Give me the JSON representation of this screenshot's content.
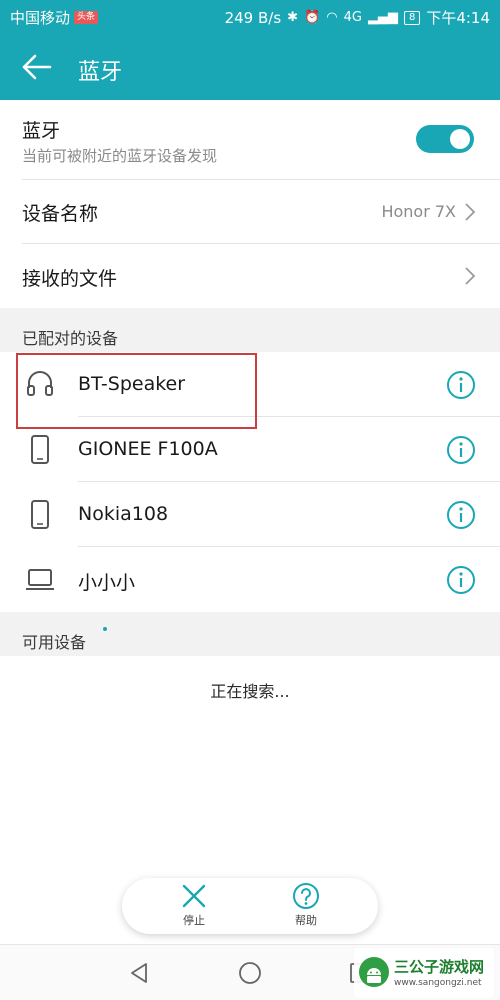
{
  "status_bar": {
    "carrier": "中国移动",
    "carrier_tag": "头条",
    "speed": "249 B/s",
    "network": "4G",
    "battery": "8",
    "time": "下午4:14"
  },
  "app_bar": {
    "title": "蓝牙",
    "back_icon": "arrow-left-icon"
  },
  "bluetooth": {
    "title": "蓝牙",
    "subtitle": "当前可被附近的蓝牙设备发现",
    "enabled": true
  },
  "device_name": {
    "label": "设备名称",
    "value": "Honor 7X"
  },
  "received_files": {
    "label": "接收的文件"
  },
  "paired_section": {
    "label": "已配对的设备",
    "devices": [
      {
        "name": "BT-Speaker",
        "icon": "headphones-icon"
      },
      {
        "name": "GIONEE F100A",
        "icon": "phone-icon"
      },
      {
        "name": "Nokia108",
        "icon": "phone-icon"
      },
      {
        "name": "小小小",
        "icon": "laptop-icon"
      }
    ]
  },
  "available_section": {
    "label": "可用设备",
    "status": "正在搜索..."
  },
  "actions": {
    "stop_label": "停止",
    "help_label": "帮助"
  },
  "watermark": {
    "title": "三公子游戏网",
    "url": "www.sangongzi.net"
  },
  "colors": {
    "accent": "#1aa7b5",
    "highlight": "#c94040"
  }
}
